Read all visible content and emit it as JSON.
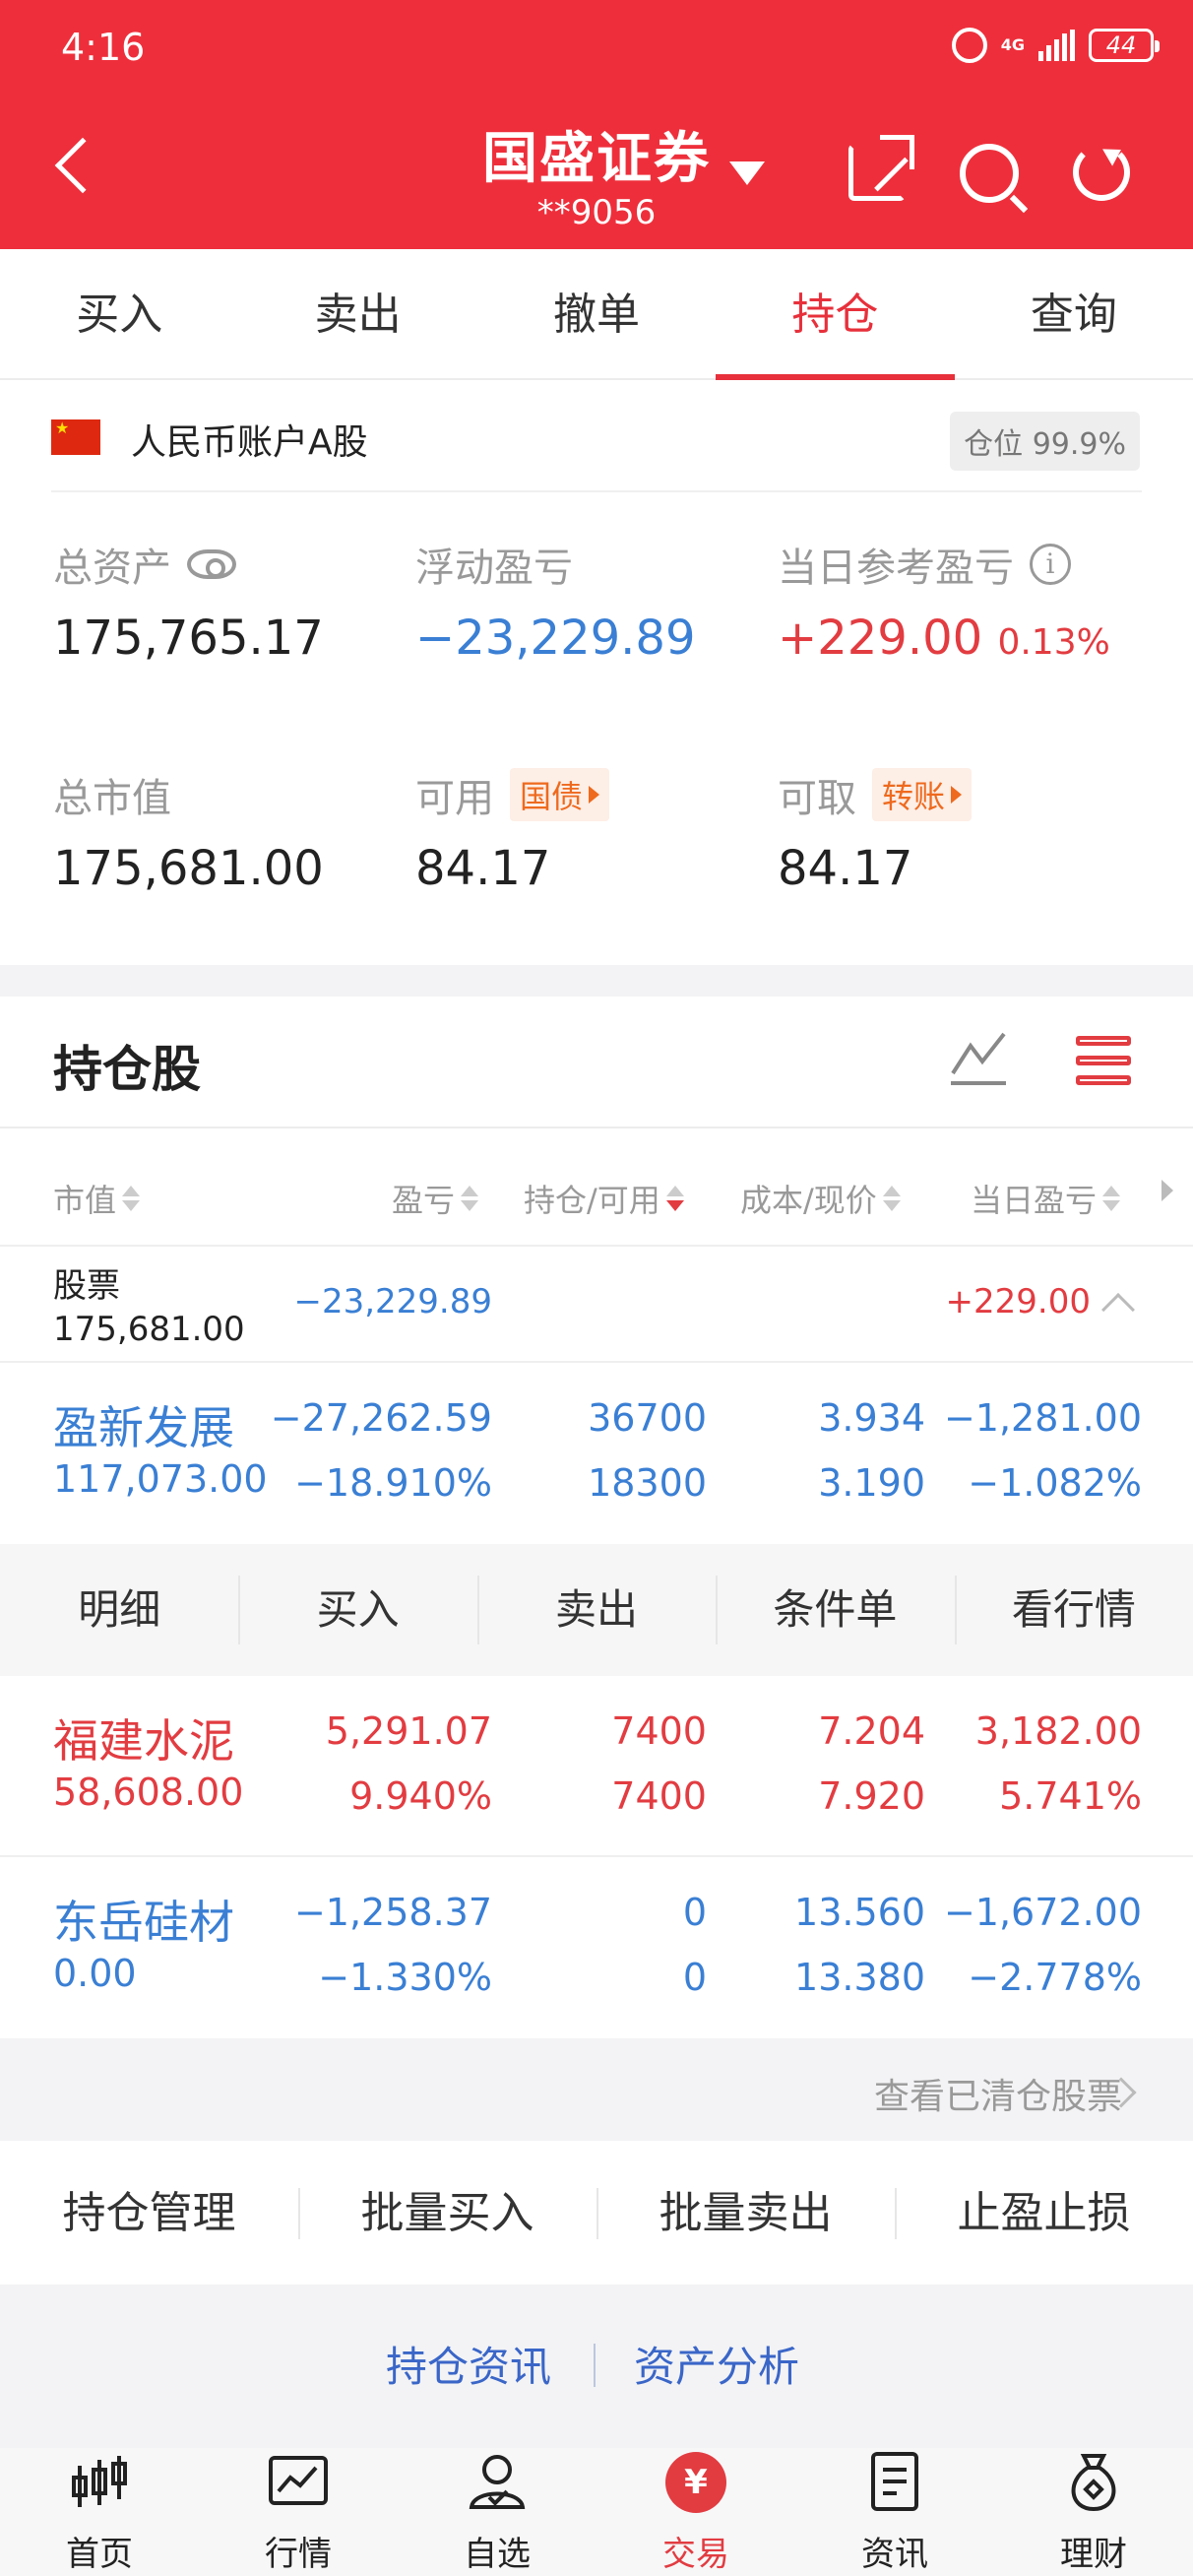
{
  "status": {
    "time": "4:16",
    "network": "4G",
    "battery": "44"
  },
  "header": {
    "title": "国盛证券",
    "account": "**9056"
  },
  "tabs": [
    {
      "label": "买入"
    },
    {
      "label": "卖出"
    },
    {
      "label": "撤单"
    },
    {
      "label": "持仓",
      "active": true
    },
    {
      "label": "查询"
    }
  ],
  "account": {
    "label": "人民币账户A股",
    "position_ratio": "仓位 99.9%",
    "total_assets_label": "总资产",
    "total_assets": "175,765.17",
    "floating_pl_label": "浮动盈亏",
    "floating_pl": "−23,229.89",
    "daily_pl_label": "当日参考盈亏",
    "daily_pl": "+229.00",
    "daily_pl_pct": "0.13%",
    "market_value_label": "总市值",
    "market_value": "175,681.00",
    "available_label": "可用",
    "available_chip": "国债",
    "available": "84.17",
    "withdrawable_label": "可取",
    "withdrawable_chip": "转账",
    "withdrawable": "84.17"
  },
  "holdings": {
    "title": "持仓股",
    "columns": {
      "market_value": "市值",
      "pl": "盈亏",
      "qty": "持仓/可用",
      "price": "成本/现价",
      "daily": "当日盈亏"
    },
    "summary": {
      "label": "股票",
      "market_value": "175,681.00",
      "pl": "−23,229.89",
      "daily": "+229.00"
    },
    "rows": [
      {
        "name": "盈新发展",
        "market_value": "117,073.00",
        "pl": "−27,262.59",
        "pl_pct": "−18.910%",
        "qty": "36700",
        "avail": "18300",
        "cost": "3.934",
        "price": "3.190",
        "daily": "−1,281.00",
        "daily_pct": "−1.082%",
        "color": "#3a7fd4"
      },
      {
        "name": "福建水泥",
        "market_value": "58,608.00",
        "pl": "5,291.07",
        "pl_pct": "9.940%",
        "qty": "7400",
        "avail": "7400",
        "cost": "7.204",
        "price": "7.920",
        "daily": "3,182.00",
        "daily_pct": "5.741%",
        "color": "#e23c41"
      },
      {
        "name": "东岳硅材",
        "market_value": "0.00",
        "pl": "−1,258.37",
        "pl_pct": "−1.330%",
        "qty": "0",
        "avail": "0",
        "cost": "13.560",
        "price": "13.380",
        "daily": "−1,672.00",
        "daily_pct": "−2.778%",
        "color": "#3a7fd4"
      }
    ],
    "row_actions": [
      "明细",
      "买入",
      "卖出",
      "条件单",
      "看行情"
    ],
    "cleared_link": "查看已清仓股票"
  },
  "management": [
    "持仓管理",
    "批量买入",
    "批量卖出",
    "止盈止损"
  ],
  "links": {
    "news": "持仓资讯",
    "analysis": "资产分析"
  },
  "bottom_nav": [
    {
      "label": "首页",
      "icon": "candlestick-icon"
    },
    {
      "label": "行情",
      "icon": "chart-icon"
    },
    {
      "label": "自选",
      "icon": "user-star-icon"
    },
    {
      "label": "交易",
      "icon": "yen-icon",
      "symbol": "¥",
      "active": true
    },
    {
      "label": "资讯",
      "icon": "document-icon"
    },
    {
      "label": "理财",
      "icon": "money-bag-icon"
    }
  ],
  "colors": {
    "brand": "#ee2f3b",
    "gain": "#e23c41",
    "loss": "#3a7fd4",
    "link": "#3a66c8"
  }
}
